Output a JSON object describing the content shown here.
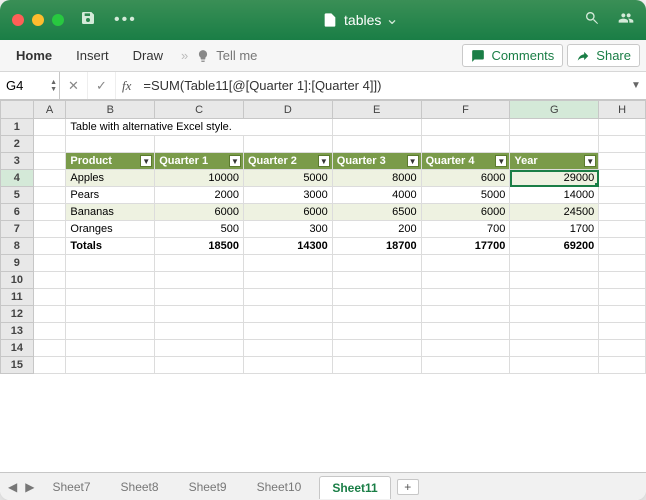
{
  "title": {
    "filename": "tables"
  },
  "ribbon": {
    "tabs": {
      "home": "Home",
      "insert": "Insert",
      "draw": "Draw"
    },
    "tellme": "Tell me",
    "comments": "Comments",
    "share": "Share"
  },
  "formula_bar": {
    "cell_ref": "G4",
    "fx_label": "fx",
    "formula": "=SUM(Table11[@[Quarter 1]:[Quarter 4]])"
  },
  "columns": [
    "A",
    "B",
    "C",
    "D",
    "E",
    "F",
    "G",
    "H"
  ],
  "rows": [
    "1",
    "2",
    "3",
    "4",
    "5",
    "6",
    "7",
    "8",
    "9",
    "10",
    "11",
    "12",
    "13",
    "14",
    "15"
  ],
  "selected": {
    "col": "G",
    "row": "4"
  },
  "caption": "Table with alternative Excel style.",
  "table": {
    "headers": [
      "Product",
      "Quarter 1",
      "Quarter 2",
      "Quarter 3",
      "Quarter 4",
      "Year"
    ],
    "rows": [
      {
        "product": "Apples",
        "q1": "10000",
        "q2": "5000",
        "q3": "8000",
        "q4": "6000",
        "year": "29000"
      },
      {
        "product": "Pears",
        "q1": "2000",
        "q2": "3000",
        "q3": "4000",
        "q4": "5000",
        "year": "14000"
      },
      {
        "product": "Bananas",
        "q1": "6000",
        "q2": "6000",
        "q3": "6500",
        "q4": "6000",
        "year": "24500"
      },
      {
        "product": "Oranges",
        "q1": "500",
        "q2": "300",
        "q3": "200",
        "q4": "700",
        "year": "1700"
      }
    ],
    "totals": {
      "label": "Totals",
      "q1": "18500",
      "q2": "14300",
      "q3": "18700",
      "q4": "17700",
      "year": "69200"
    }
  },
  "sheet_tabs": [
    "Sheet7",
    "Sheet8",
    "Sheet9",
    "Sheet10",
    "Sheet11"
  ],
  "active_sheet": "Sheet11"
}
